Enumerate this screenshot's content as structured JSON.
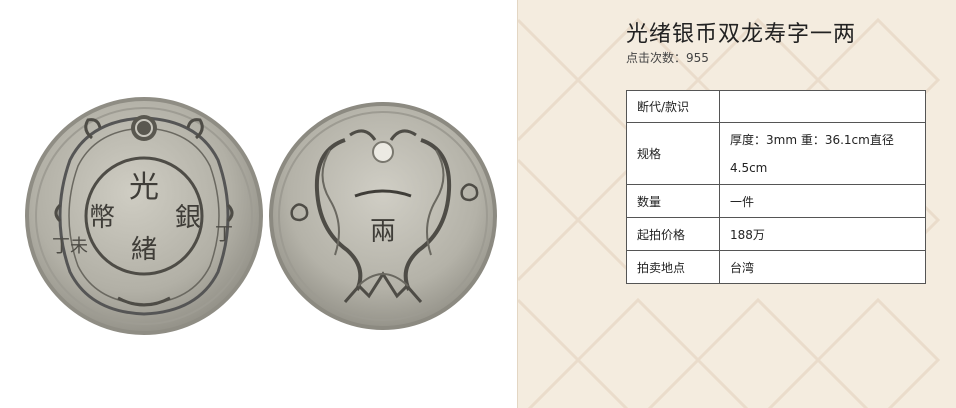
{
  "item": {
    "title": "光绪银币双龙寿字一两",
    "clicks_label": "点击次数：",
    "clicks_value": "955"
  },
  "coin": {
    "obverse_chars": [
      "光",
      "緒",
      "銀",
      "幣"
    ],
    "obverse_left": "丁未",
    "obverse_right": "丁",
    "reverse_char": "兩"
  },
  "specs": [
    {
      "key": "断代/款识",
      "value": ""
    },
    {
      "key": "规格",
      "value": "厚度：3mm 重：36.1cm直径4.5cm"
    },
    {
      "key": "数量",
      "value": "一件"
    },
    {
      "key": "起拍价格",
      "value": "188万"
    },
    {
      "key": "拍卖地点",
      "value": "台湾"
    }
  ],
  "colors": {
    "panel_bg": "#f4ecdf",
    "pattern_line": "#eadccb",
    "coin_base": "#b6b4aa",
    "coin_rim": "#8f8d84",
    "coin_dark": "#4e4c46"
  }
}
